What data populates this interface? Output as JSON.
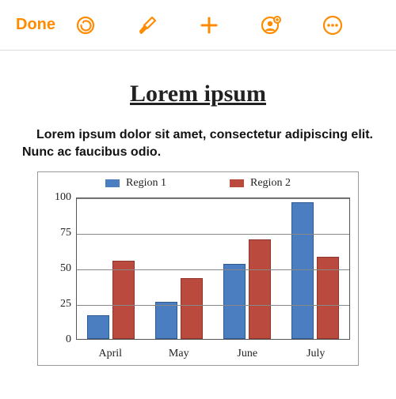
{
  "toolbar": {
    "done_label": "Done"
  },
  "doc": {
    "title": "Lorem ipsum ",
    "body": "Lorem ipsum dolor sit amet, consectetur adipiscing elit. Nunc ac faucibus odio."
  },
  "colors": {
    "accent": "#ff8c00",
    "series1": "#4a7ec0",
    "series2": "#b94a3d"
  },
  "chart_data": {
    "type": "bar",
    "categories": [
      "April",
      "May",
      "June",
      "July"
    ],
    "series": [
      {
        "name": "Region 1",
        "values": [
          17,
          26,
          53,
          96
        ]
      },
      {
        "name": "Region 2",
        "values": [
          55,
          43,
          70,
          58
        ]
      }
    ],
    "ylim": [
      0,
      100
    ],
    "yticks": [
      0,
      25,
      50,
      75,
      100
    ],
    "title": "",
    "xlabel": "",
    "ylabel": ""
  }
}
